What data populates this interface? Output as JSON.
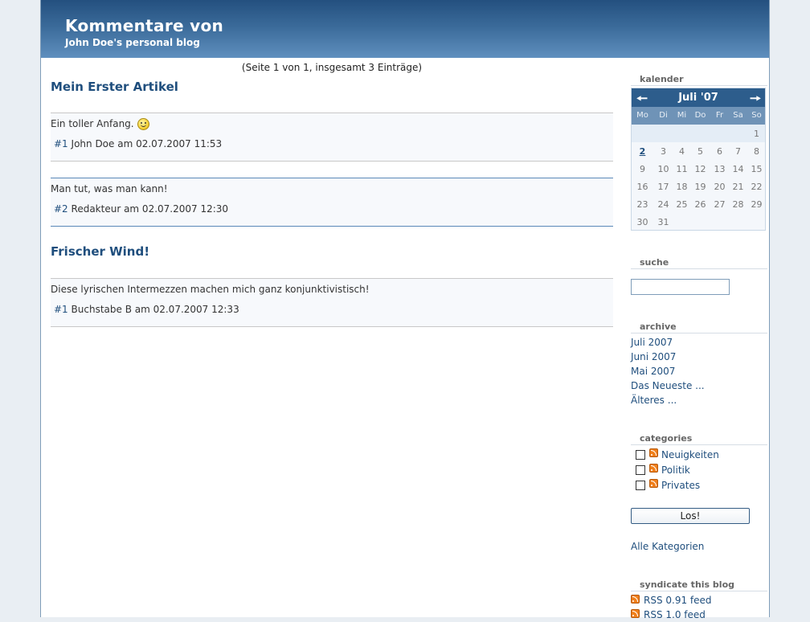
{
  "header": {
    "title": "Kommentare von",
    "subtitle": "John Doe's personal blog"
  },
  "main": {
    "pageinfo": "(Seite 1 von 1, insgesamt 3 Einträge)",
    "entries": [
      {
        "title": "Mein Erster Artikel",
        "comments": [
          {
            "text": "Ein toller Anfang.",
            "smiley": "wink-smiley-icon",
            "number": "#1",
            "meta": "John Doe am 02.07.2007 11:53"
          },
          {
            "text": "Man tut, was man kann!",
            "number": "#2",
            "meta": "Redakteur am 02.07.2007 12:30"
          }
        ]
      },
      {
        "title": "Frischer Wind!",
        "comments": [
          {
            "text": "Diese lyrischen Intermezzen machen mich ganz konjunktivistisch!",
            "number": "#1",
            "meta": "Buchstabe B am 02.07.2007 12:33"
          }
        ]
      }
    ]
  },
  "sidebar": {
    "calendar": {
      "title": "kalender",
      "month": "Juli '07",
      "prev_icon": "arrow-left-icon",
      "next_icon": "arrow-right-icon",
      "weekdays": [
        "Mo",
        "Di",
        "Mi",
        "Do",
        "Fr",
        "Sa",
        "So"
      ],
      "weeks": [
        [
          "",
          "",
          "",
          "",
          "",
          "",
          "1"
        ],
        [
          "2",
          "3",
          "4",
          "5",
          "6",
          "7",
          "8"
        ],
        [
          "9",
          "10",
          "11",
          "12",
          "13",
          "14",
          "15"
        ],
        [
          "16",
          "17",
          "18",
          "19",
          "20",
          "21",
          "22"
        ],
        [
          "23",
          "24",
          "25",
          "26",
          "27",
          "28",
          "29"
        ],
        [
          "30",
          "31",
          "",
          "",
          "",
          "",
          ""
        ]
      ],
      "today": "2"
    },
    "search": {
      "title": "suche",
      "value": ""
    },
    "archive": {
      "title": "archive",
      "items": [
        "Juli 2007",
        "Juni 2007",
        "Mai 2007",
        "Das Neueste ...",
        "Älteres ..."
      ]
    },
    "categories": {
      "title": "categories",
      "items": [
        "Neuigkeiten",
        "Politik",
        "Privates"
      ],
      "button": "Los!",
      "all": "Alle Kategorien"
    },
    "syndicate": {
      "title": "syndicate this blog",
      "feeds": [
        "RSS 0.91 feed",
        "RSS 1.0 feed"
      ]
    }
  },
  "colors": {
    "header": "#2d5d8c",
    "link": "#1f4e7d",
    "rss": "#f07f1b"
  }
}
